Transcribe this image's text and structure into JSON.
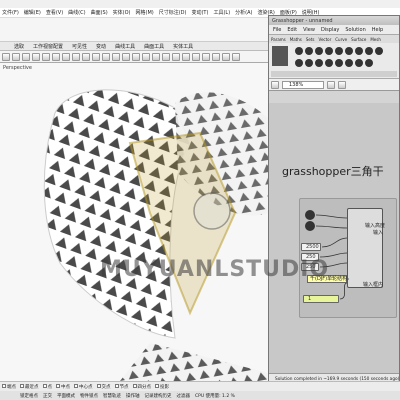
{
  "rhino": {
    "menu": [
      "文件(F)",
      "编辑(E)",
      "查看(V)",
      "曲线(C)",
      "曲面(S)",
      "实体(O)",
      "网格(M)",
      "尺寸标注(D)",
      "变动(T)",
      "工具(L)",
      "分析(A)",
      "渲染(R)",
      "面板(P)",
      "说明(H)"
    ],
    "tabs": [
      "选取",
      "工作视窗配置",
      "可见性",
      "变动",
      "曲线工具",
      "曲面工具",
      "实体工具"
    ],
    "viewport_label": "Perspective",
    "osnaps": [
      "端点",
      "最近点",
      "点",
      "中点",
      "中心点",
      "交点",
      "节点",
      "四分点",
      "投影"
    ],
    "status": [
      "锁定格点",
      "正交",
      "平面模式",
      "物件锁点",
      "智慧轨迹",
      "操作轴",
      "记录建构历史",
      "过滤器",
      "CPU 使用量: 1.2 %"
    ]
  },
  "gh": {
    "window_title": "Grasshopper - unnamed",
    "menu": [
      "File",
      "Edit",
      "View",
      "Display",
      "Solution",
      "Help"
    ],
    "tabs": [
      "Params",
      "Maths",
      "Sets",
      "Vector",
      "Curve",
      "Surface",
      "Mesh"
    ],
    "zoom": "138%",
    "status": "Solution completed in ~169.9 seconds (150 seconds ago)",
    "nodes": {
      "sliders": [
        "2500",
        "250",
        "250"
      ],
      "panel_label": "千(DJF)单轮结构",
      "in_labels": [
        "输入高度",
        "输入",
        "输入框内"
      ],
      "num": "1"
    }
  },
  "overlay": {
    "caption": "grasshopper三角干",
    "watermark": "MUYUANLSTUDIO"
  },
  "colors": {
    "accent": "#b89a1e",
    "canvas": "#c8c8c8",
    "slider": "#f2f2f2",
    "panel": "#ffffaa",
    "group": "#e8f59a"
  }
}
